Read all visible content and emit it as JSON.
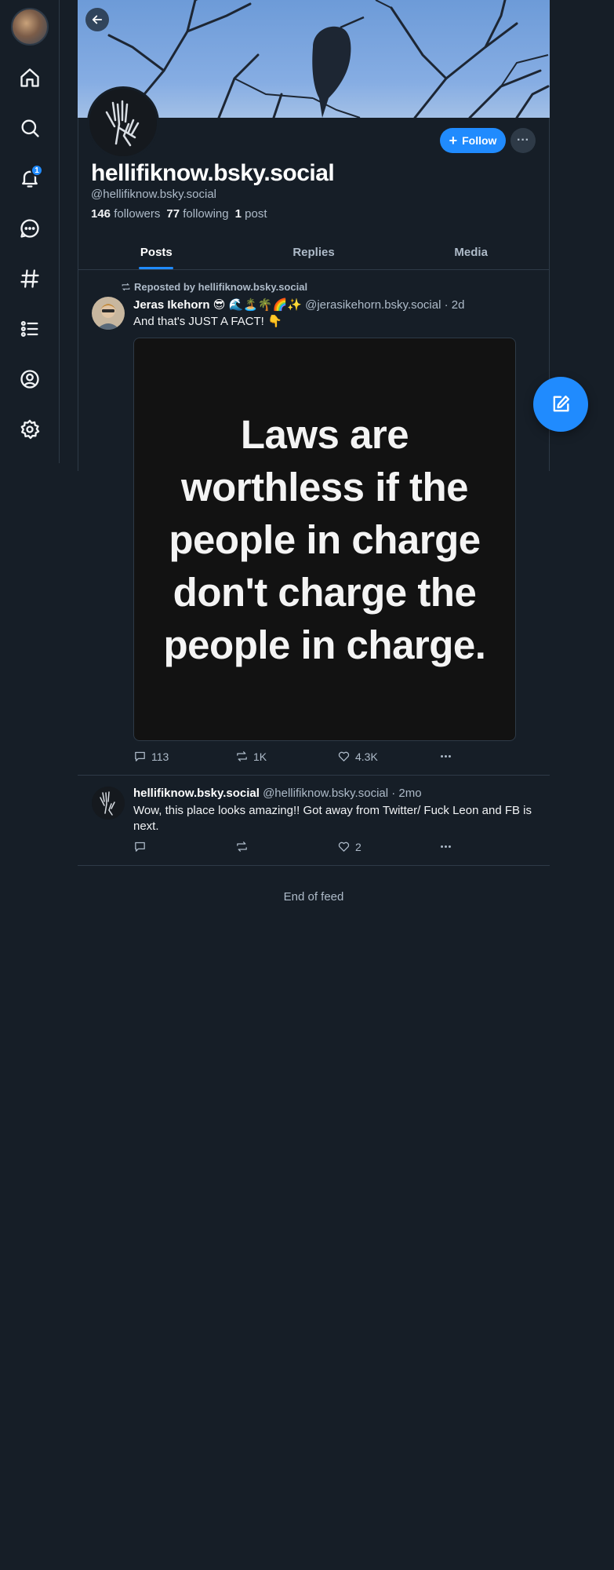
{
  "nav": {
    "items": [
      {
        "name": "home"
      },
      {
        "name": "search"
      },
      {
        "name": "notifications",
        "badge": "1"
      },
      {
        "name": "chat"
      },
      {
        "name": "feeds"
      },
      {
        "name": "lists"
      },
      {
        "name": "profile"
      },
      {
        "name": "settings"
      }
    ]
  },
  "profile": {
    "display_name": "hellifiknow.bsky.social",
    "handle": "@hellifiknow.bsky.social",
    "followers_count": "146",
    "followers_label": "followers",
    "following_count": "77",
    "following_label": "following",
    "posts_count": "1",
    "posts_label": "post",
    "follow_label": "Follow",
    "more_label": "···"
  },
  "tabs": [
    {
      "label": "Posts",
      "active": true
    },
    {
      "label": "Replies",
      "active": false
    },
    {
      "label": "Media",
      "active": false
    }
  ],
  "posts": [
    {
      "repost_label": "Reposted by hellifiknow.bsky.social",
      "author_name": "Jeras Ikehorn 😎 🌊🏝️🌴🌈✨",
      "author_handle": "@jerasikehorn.bsky.social",
      "time": "· 2d",
      "text": "And that's JUST A FACT! 👇",
      "image_text": "Laws are worthless if the people in charge don't charge the people in charge.",
      "replies": "113",
      "reposts": "1K",
      "likes": "4.3K"
    },
    {
      "author_name": "hellifiknow.bsky.social",
      "author_handle": "@hellifiknow.bsky.social",
      "time": "· 2mo",
      "text": "Wow, this place looks amazing!! Got away from Twitter/ Fuck Leon and FB is next.",
      "replies": "",
      "reposts": "",
      "likes": "2"
    }
  ],
  "feed": {
    "end_label": "End of feed"
  },
  "colors": {
    "background": "#161e27",
    "accent": "#208bfe",
    "border": "#2e3a47",
    "muted_text": "#aebbc9"
  }
}
